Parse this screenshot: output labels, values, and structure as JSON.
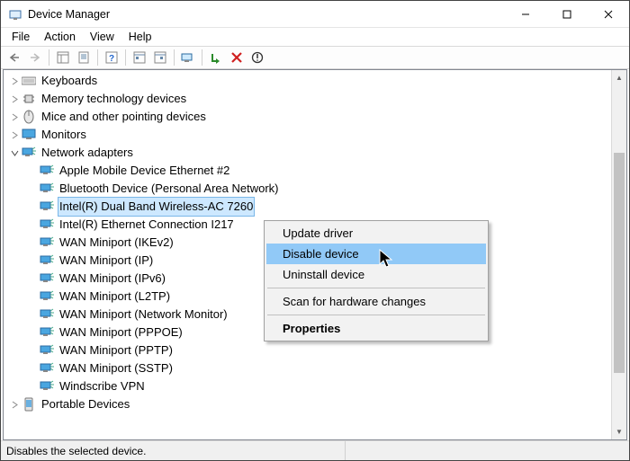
{
  "window": {
    "title": "Device Manager"
  },
  "menu": {
    "file": "File",
    "action": "Action",
    "view": "View",
    "help": "Help"
  },
  "tree": {
    "keyboards": "Keyboards",
    "memtech": "Memory technology devices",
    "mice": "Mice and other pointing devices",
    "monitors": "Monitors",
    "netadapters": "Network adapters",
    "portable": "Portable Devices",
    "net": [
      "Apple Mobile Device Ethernet #2",
      "Bluetooth Device (Personal Area Network)",
      "Intel(R) Dual Band Wireless-AC 7260",
      "Intel(R) Ethernet Connection I217",
      "WAN Miniport (IKEv2)",
      "WAN Miniport (IP)",
      "WAN Miniport (IPv6)",
      "WAN Miniport (L2TP)",
      "WAN Miniport (Network Monitor)",
      "WAN Miniport (PPPOE)",
      "WAN Miniport (PPTP)",
      "WAN Miniport (SSTP)",
      "Windscribe VPN"
    ]
  },
  "context_menu": {
    "update": "Update driver",
    "disable": "Disable device",
    "uninstall": "Uninstall device",
    "scan": "Scan for hardware changes",
    "properties": "Properties"
  },
  "status": {
    "text": "Disables the selected device."
  }
}
